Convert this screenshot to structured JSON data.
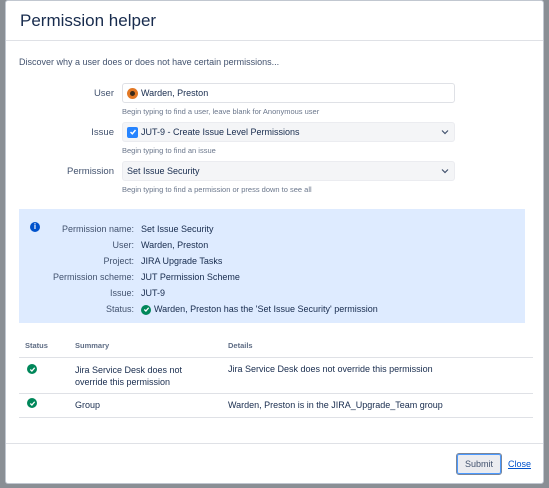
{
  "dialog": {
    "title": "Permission helper",
    "intro": "Discover why a user does or does not have certain permissions..."
  },
  "form": {
    "user": {
      "label": "User",
      "value": "Warden, Preston",
      "hint": "Begin typing to find a user, leave blank for Anonymous user"
    },
    "issue": {
      "label": "Issue",
      "value": "JUT-9 - Create Issue Level Permissions",
      "hint": "Begin typing to find an issue"
    },
    "permission": {
      "label": "Permission",
      "value": "Set Issue Security",
      "hint": "Begin typing to find a permission or press down to see all"
    }
  },
  "result": {
    "rows": [
      {
        "key": "Permission name:",
        "value": "Set Issue Security"
      },
      {
        "key": "User:",
        "value": "Warden, Preston"
      },
      {
        "key": "Project:",
        "value": "JIRA Upgrade Tasks"
      },
      {
        "key": "Permission scheme:",
        "value": "JUT Permission Scheme"
      },
      {
        "key": "Issue:",
        "value": "JUT-9"
      },
      {
        "key": "Status:",
        "value": "Warden, Preston has the 'Set Issue Security' permission"
      }
    ]
  },
  "table": {
    "headers": [
      "Status",
      "Summary",
      "Details"
    ],
    "rows": [
      {
        "summary": "Jira Service Desk does not override this permission",
        "details": "Jira Service Desk does not override this permission"
      },
      {
        "summary": "Group",
        "details": "Warden, Preston is in the JIRA_Upgrade_Team group"
      }
    ]
  },
  "footer": {
    "submit": "Submit",
    "close": "Close"
  },
  "colors": {
    "accent": "#0052cc",
    "success": "#00875a",
    "info_bg": "#deebff"
  }
}
